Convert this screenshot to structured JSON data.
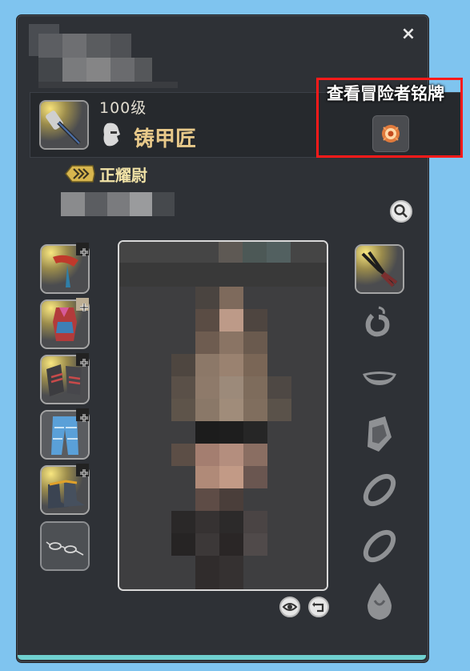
{
  "window": {
    "close_label": "×"
  },
  "character": {
    "level": "100级",
    "job_name": "铸甲匠",
    "title": "正耀尉"
  },
  "adventurer_plate": {
    "label": "查看冒险者铭牌"
  },
  "icons": {
    "close": "close-icon",
    "job": "armorer-job-icon",
    "plate": "adventurer-plate-icon",
    "rank": "grand-company-rank-icon",
    "search": "magnifier-icon",
    "eye": "eye-icon",
    "rotate": "rotate-icon"
  },
  "left_gear_slots": [
    "head",
    "body",
    "hands",
    "legs",
    "feet",
    "glasses"
  ],
  "right_gear_slots": [
    "off-hand-tool",
    "earrings",
    "necklace",
    "bracelet",
    "ring-1",
    "ring-2",
    "soul-crystal"
  ],
  "colors": {
    "background": "#7fc4ef",
    "window": "#2e3136",
    "highlight": "#ff1a1a",
    "job_name": "#e8c98a",
    "title": "#f2e3a7"
  }
}
